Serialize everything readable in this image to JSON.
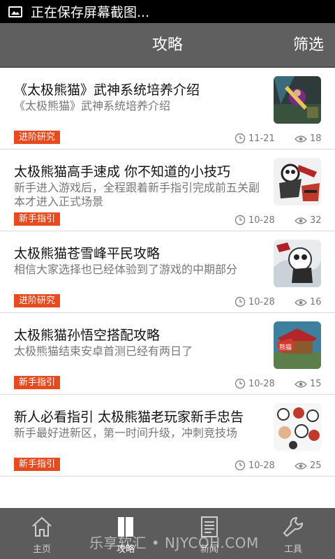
{
  "status_bar": {
    "text": "正在保存屏幕截图..."
  },
  "header": {
    "title": "攻略",
    "filter_label": "筛选"
  },
  "articles": [
    {
      "title": "《太极熊猫》武神系统培养介绍",
      "desc": "《太极熊猫》武神系统培养介绍",
      "tag": "进阶研究",
      "date": "11-21",
      "views": "18"
    },
    {
      "title": "太极熊猫高手速成 你不知道的小技巧",
      "desc": "新手进入游戏后，全程跟着新手指引完成前五关副本才进入正式场景",
      "tag": "新手指引",
      "date": "10-28",
      "views": "32"
    },
    {
      "title": "太极熊猫苍雪峰平民攻略",
      "desc": "相信大家选择也已经体验到了游戏的中期部分",
      "tag": "进阶研究",
      "date": "10-28",
      "views": "16"
    },
    {
      "title": "太极熊猫孙悟空搭配攻略",
      "desc": "太极熊猫结束安卓首测已经有两日了",
      "tag": "新手指引",
      "date": "10-28",
      "views": "15"
    },
    {
      "title": "新人必看指引 太极熊猫老玩家新手忠告",
      "desc": "新手最好进新区，第一时间升级，冲刺竞技场",
      "tag": "新手指引",
      "date": "10-28",
      "views": "25"
    }
  ],
  "nav": [
    {
      "label": "主页",
      "icon": "home-icon"
    },
    {
      "label": "攻略",
      "icon": "book-icon",
      "active": true
    },
    {
      "label": "新闻",
      "icon": "news-icon"
    },
    {
      "label": "工具",
      "icon": "wrench-icon"
    }
  ],
  "watermark": "乐享软汇 • NJYCOH.COM"
}
